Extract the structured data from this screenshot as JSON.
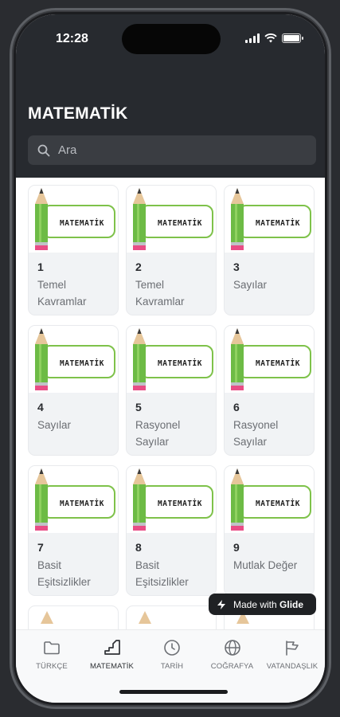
{
  "status_bar": {
    "time": "12:28"
  },
  "header": {
    "title": "MATEMATİK",
    "search": {
      "placeholder": "Ara",
      "value": ""
    }
  },
  "cards": [
    {
      "image_label": "MATEMATİK",
      "number": "1",
      "title": "Temel Kavramlar"
    },
    {
      "image_label": "MATEMATİK",
      "number": "2",
      "title": "Temel Kavramlar"
    },
    {
      "image_label": "MATEMATİK",
      "number": "3",
      "title": "Sayılar"
    },
    {
      "image_label": "MATEMATİK",
      "number": "4",
      "title": "Sayılar"
    },
    {
      "image_label": "MATEMATİK",
      "number": "5",
      "title": "Rasyonel Sayılar"
    },
    {
      "image_label": "MATEMATİK",
      "number": "6",
      "title": "Rasyonel Sayılar"
    },
    {
      "image_label": "MATEMATİK",
      "number": "7",
      "title": "Basit Eşitsizlikler"
    },
    {
      "image_label": "MATEMATİK",
      "number": "8",
      "title": "Basit Eşitsizlikler"
    },
    {
      "image_label": "MATEMATİK",
      "number": "9",
      "title": "Mutlak Değer"
    }
  ],
  "badge": {
    "prefix": "Made with",
    "brand": "Glide"
  },
  "tabbar": {
    "items": [
      {
        "label": "TÜRKÇE",
        "icon": "folder-icon",
        "active": false
      },
      {
        "label": "MATEMATİK",
        "icon": "stairs-icon",
        "active": true
      },
      {
        "label": "TARİH",
        "icon": "clock-icon",
        "active": false
      },
      {
        "label": "COĞRAFYA",
        "icon": "globe-icon",
        "active": false
      },
      {
        "label": "VATANDAŞLIK",
        "icon": "flag-icon",
        "active": false
      }
    ]
  },
  "colors": {
    "header_bg": "#272a2f",
    "card_bg": "#f1f3f5",
    "pencil_green": "#6dbb45",
    "pencil_eraser": "#e94d86",
    "label_border": "#7ec24a"
  }
}
